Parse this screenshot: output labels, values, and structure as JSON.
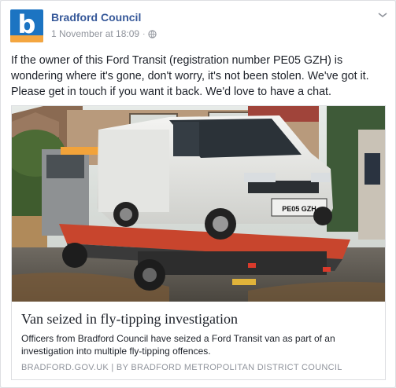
{
  "post": {
    "page_name": "Bradford Council",
    "avatar_letter": "b",
    "timestamp": "1 November at 18:09",
    "separator": "·",
    "text": "If the owner of this Ford Transit (registration number PE05 GZH) is wondering where it's gone, don't worry, it's not been stolen. We've got it. Please get in touch if you want it back. We'd love to have a chat."
  },
  "link": {
    "title": "Van seized in fly-tipping investigation",
    "description": "Officers from Bradford Council have seized a Ford Transit van as part of an investigation into multiple fly-tipping offences.",
    "source": "BRADFORD.GOV.UK | BY BRADFORD METROPOLITAN DISTRICT COUNCIL"
  },
  "photo": {
    "number_plate": "PE05 GZH"
  },
  "colors": {
    "brand_blue": "#1c74c2",
    "brand_orange": "#f4a640",
    "link_blue": "#365899",
    "meta_grey": "#90949c"
  },
  "icons": {
    "privacy": "globe-icon",
    "menu": "chevron-down-icon"
  }
}
